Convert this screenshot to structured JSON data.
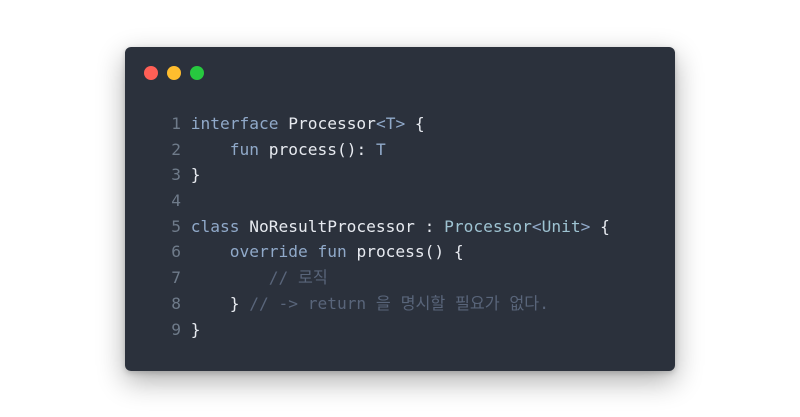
{
  "window": {
    "buttons": {
      "close": "#ff5f56",
      "minimize": "#ffbd2e",
      "maximize": "#27c93f"
    }
  },
  "code": {
    "lines": [
      {
        "num": "1",
        "tokens": [
          {
            "t": "interface",
            "c": "kw"
          },
          {
            "t": " Processor",
            "c": "fn"
          },
          {
            "t": "<",
            "c": "angle"
          },
          {
            "t": "T",
            "c": "kw"
          },
          {
            "t": ">",
            "c": "angle"
          },
          {
            "t": " {",
            "c": "punct"
          }
        ]
      },
      {
        "num": "2",
        "tokens": [
          {
            "t": "    ",
            "c": "punct"
          },
          {
            "t": "fun",
            "c": "kw"
          },
          {
            "t": " process(): ",
            "c": "fn"
          },
          {
            "t": "T",
            "c": "kw"
          }
        ]
      },
      {
        "num": "3",
        "tokens": [
          {
            "t": "}",
            "c": "punct"
          }
        ]
      },
      {
        "num": "4",
        "tokens": []
      },
      {
        "num": "5",
        "tokens": [
          {
            "t": "class",
            "c": "kw"
          },
          {
            "t": " NoResultProcessor : ",
            "c": "fn"
          },
          {
            "t": "Processor",
            "c": "type"
          },
          {
            "t": "<",
            "c": "angle"
          },
          {
            "t": "Unit",
            "c": "type"
          },
          {
            "t": ">",
            "c": "angle"
          },
          {
            "t": " {",
            "c": "punct"
          }
        ]
      },
      {
        "num": "6",
        "tokens": [
          {
            "t": "    ",
            "c": "punct"
          },
          {
            "t": "override",
            "c": "kw"
          },
          {
            "t": " ",
            "c": "punct"
          },
          {
            "t": "fun",
            "c": "kw"
          },
          {
            "t": " process() {",
            "c": "fn"
          }
        ]
      },
      {
        "num": "7",
        "tokens": [
          {
            "t": "        ",
            "c": "punct"
          },
          {
            "t": "// 로직",
            "c": "comment"
          }
        ]
      },
      {
        "num": "8",
        "tokens": [
          {
            "t": "    } ",
            "c": "punct"
          },
          {
            "t": "// -> return 을 명시할 필요가 없다.",
            "c": "comment"
          }
        ]
      },
      {
        "num": "9",
        "tokens": [
          {
            "t": "}",
            "c": "punct"
          }
        ]
      }
    ]
  }
}
